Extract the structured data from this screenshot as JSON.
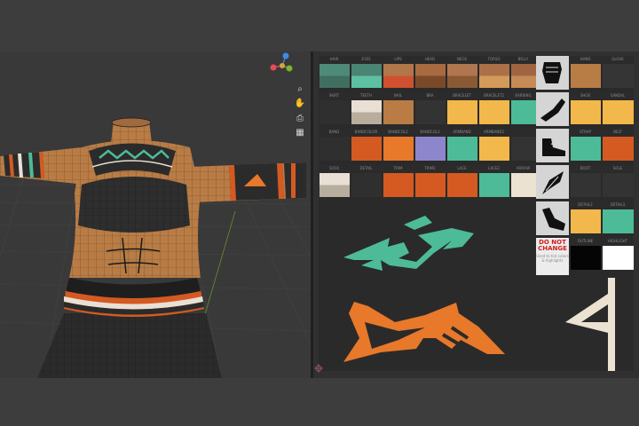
{
  "app": {
    "colors": {
      "background": "#3d3d3d",
      "viewport": "#393939",
      "uv_editor": "#303030"
    }
  },
  "viewport": {
    "tools": [
      {
        "name": "zoom-icon",
        "glyph": "⌕"
      },
      {
        "name": "pan-hand-icon",
        "glyph": "✋"
      },
      {
        "name": "camera-icon",
        "glyph": "⎙"
      },
      {
        "name": "grid-view-icon",
        "glyph": "▦"
      }
    ],
    "gizmo": {
      "axes": [
        {
          "label": "X",
          "color": "#e64d59"
        },
        {
          "label": "Y",
          "color": "#7ab32e"
        },
        {
          "label": "Z",
          "color": "#3f8ae6"
        }
      ]
    }
  },
  "texture": {
    "rows": [
      {
        "labels": [
          "HAIR",
          "EYES",
          "LIPS",
          "HEAD",
          "NECK",
          "TORSO",
          "BELLY",
          "",
          "HAND",
          "GLOVE"
        ],
        "swatches": [
          {
            "top": "#4f8a78",
            "bottom": "#3f6f60"
          },
          {
            "top": "#4a8472",
            "bottom": "#5ec0a2"
          },
          {
            "top": "#b0774a",
            "bottom": "#d05030"
          },
          {
            "top": "#a86a40",
            "bottom": "#7a4a28"
          },
          {
            "top": "#b07650",
            "bottom": "#8a5a35"
          },
          {
            "top": "#ab7048",
            "bottom": "#d49a5a"
          },
          {
            "top": "#a06540",
            "bottom": "#c58a55"
          },
          {
            "top": "",
            "bottom": ""
          },
          {
            "top": "#b87c45",
            "bottom": "#b87c45"
          },
          {
            "top": "#353535",
            "bottom": "#353535"
          }
        ]
      },
      {
        "labels": [
          "SKIRT",
          "TEETH",
          "NAIL",
          "BRA",
          "BRACELET",
          "BRACELET2",
          "EARRING",
          "",
          "SHOE",
          "SANDAL"
        ],
        "swatches": [
          {
            "top": "#2f2f2f",
            "bottom": "#2f2f2f"
          },
          {
            "top": "#e8e0d4",
            "bottom": "#b8ae9e"
          },
          {
            "top": "#b97c45",
            "bottom": "#b97c45"
          },
          {
            "top": "#333333",
            "bottom": "#333333"
          },
          {
            "top": "#f2b84b",
            "bottom": "#f2b84b"
          },
          {
            "top": "#f2b84b",
            "bottom": "#f2b84b"
          },
          {
            "top": "#4dbb98",
            "bottom": "#4dbb98"
          },
          {
            "top": "",
            "bottom": ""
          },
          {
            "top": "#f2b84b",
            "bottom": "#f2b84b"
          },
          {
            "top": "#f2b84b",
            "bottom": "#f2b84b"
          }
        ]
      },
      {
        "labels": [
          "BAND",
          "BANDCOLOR",
          "BANDCOL2",
          "BANDCOL3",
          "ARMBAND",
          "ARMBAND2",
          "",
          "",
          "STRAP",
          "BELT"
        ],
        "swatches": [
          {
            "top": "#2f2f2f",
            "bottom": "#2f2f2f"
          },
          {
            "top": "#d45a22",
            "bottom": "#d45a22"
          },
          {
            "top": "#e8782a",
            "bottom": "#e8782a"
          },
          {
            "top": "#8e86cc",
            "bottom": "#8e86cc"
          },
          {
            "top": "#4dbb98",
            "bottom": "#4dbb98"
          },
          {
            "top": "#f2b84b",
            "bottom": "#f2b84b"
          },
          {
            "top": "#333333",
            "bottom": "#333333"
          },
          {
            "top": "",
            "bottom": ""
          },
          {
            "top": "#4dbb98",
            "bottom": "#4dbb98"
          },
          {
            "top": "#d45a22",
            "bottom": "#d45a22"
          }
        ]
      },
      {
        "labels": [
          "SOCK",
          "DETAIL",
          "TRIM",
          "TRIM2",
          "LACE",
          "LACE2",
          "ARROW",
          "",
          "BOOT",
          "SOLE"
        ],
        "swatches": [
          {
            "top": "#e8e0d4",
            "bottom": "#b8ae9e"
          },
          {
            "top": "#2f2f2f",
            "bottom": "#2f2f2f"
          },
          {
            "top": "#d45a22",
            "bottom": "#d45a22"
          },
          {
            "top": "#d45a22",
            "bottom": "#d45a22"
          },
          {
            "top": "#d45a22",
            "bottom": "#d45a22"
          },
          {
            "top": "#4dbb98",
            "bottom": "#4dbb98"
          },
          {
            "top": "#ebe2d2",
            "bottom": "#ebe2d2"
          },
          {
            "top": "",
            "bottom": ""
          },
          {
            "top": "#333333",
            "bottom": "#333333"
          },
          {
            "top": "#333333",
            "bottom": "#333333"
          }
        ]
      }
    ],
    "extra_rows": [
      {
        "labels": [
          "DETAIL2",
          "DETAIL3"
        ],
        "swatches": [
          "#f2b84b",
          "#4dbb98"
        ]
      },
      {
        "labels": [
          "OUTLINE",
          "HIGHLIGHT"
        ],
        "swatches": [
          "#050505",
          "#ffffff"
        ]
      }
    ],
    "icons": [
      "fist-icon",
      "arm-icon",
      "shoe-icon",
      "feather-icon",
      "bent-arm-icon"
    ],
    "do_not_change": {
      "title": "DO NOT CHANGE",
      "subtitle": "Used to tint colors & highlights"
    },
    "motifs": {
      "teal": "#4dbb98",
      "orange": "#e8782a",
      "cream": "#ebe2d2"
    }
  }
}
